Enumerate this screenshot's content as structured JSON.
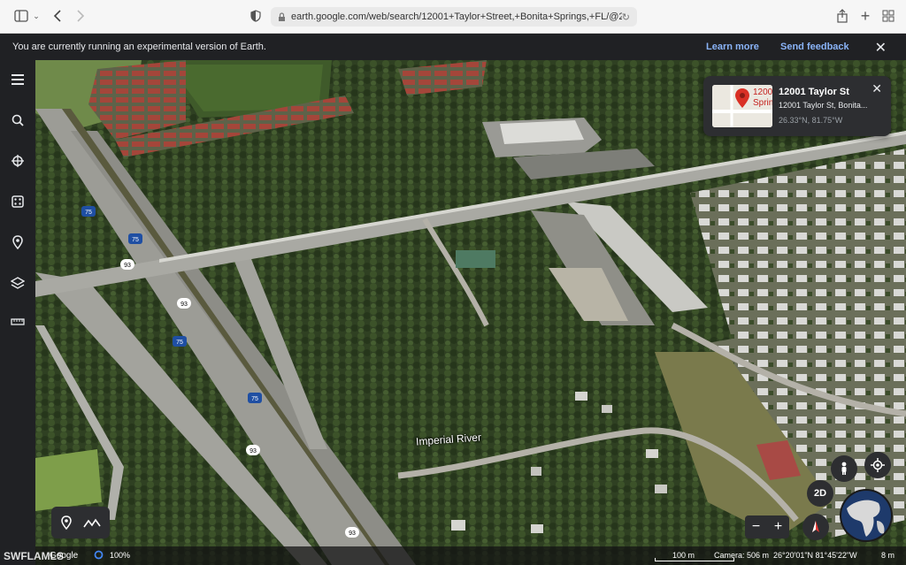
{
  "browser": {
    "url": "earth.google.com/web/search/12001+Taylor+Street,+Bonita+Springs,+FL/@26.3333"
  },
  "banner": {
    "message": "You are currently running an experimental version of Earth.",
    "learn_more": "Learn more",
    "send_feedback": "Send feedback"
  },
  "info_card": {
    "title": "12001 Taylor St",
    "address": "12001 Taylor St, Bonita...",
    "coords": "26.33°N, 81.75°W",
    "thumb_text_1": "1200",
    "thumb_text_2": "Sprin"
  },
  "map": {
    "street_label": "Imperial River",
    "road_shields": [
      "75",
      "75",
      "75",
      "75",
      "93",
      "93",
      "93",
      "93"
    ]
  },
  "controls": {
    "view_mode": "2D"
  },
  "status": {
    "google": "Google",
    "zoom": "100%",
    "scale": "100 m",
    "camera": "Camera: 506 m",
    "coords": "26°20'01\"N 81°45'22\"W",
    "elevation": "8 m"
  },
  "watermark": "SWFLAMLS",
  "colors": {
    "accent": "#8ab4f8",
    "panel": "#2d2e31",
    "rail": "#202124"
  }
}
